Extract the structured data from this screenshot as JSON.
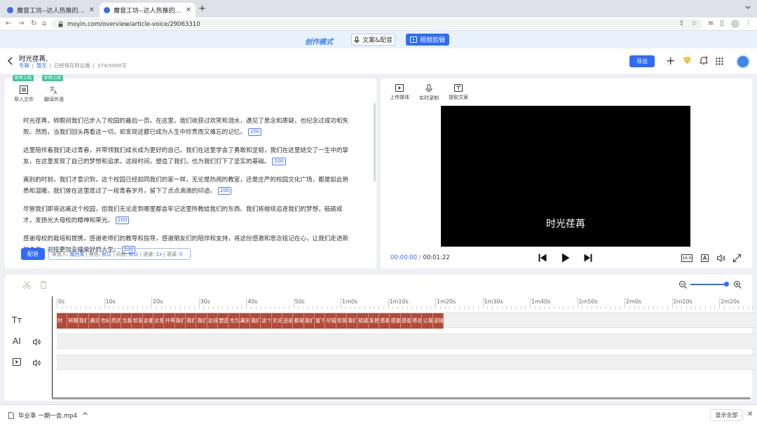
{
  "browser": {
    "tabs": [
      {
        "title": "魔音工坊--达人热推的短视频/有声...",
        "active": false
      },
      {
        "title": "魔音工坊--达人热推的短视频/有声...",
        "active": true
      }
    ],
    "new_tab": "+",
    "url": "moyin.com/overview/article-voice/29063310"
  },
  "modebar": {
    "mode_label": "创作模式",
    "btn_text_voice": "文案&配音",
    "btn_video_edit": "视频剪辑"
  },
  "header": {
    "title": "时光荏苒,",
    "tag1": "专辑",
    "tag2": "暂无",
    "save_status": "已经保存到云端",
    "word_count": "374/5000字",
    "export_label": "导出"
  },
  "editor": {
    "tools": [
      {
        "label": "导入文件",
        "badge": "即将上线"
      },
      {
        "label": "翻译外语",
        "badge": "即将上线"
      }
    ],
    "paragraphs": [
      {
        "text": "时光荏苒，转眼间我们已步入了校园的最后一页。在这里，我们收获过欢笑和泪水，遇见了思念和质疑，也纪念过成功和失败。然而，当我们回头再看这一切，却发现这都已成为人生中珍贵而又难忘的记忆。",
        "count": "200"
      },
      {
        "text": "这里陪伴着我们走过青春，并带领我们成长成为更好的自己。我们在这里学会了勇敢和坚韧，我们在这里结交了一生中的挚友，在这里发现了自己的梦想和追求。这段时间，塑造了我们，也为我们打下了坚实的基础。",
        "count": "200"
      },
      {
        "text": "离别的时刻，我们才意识到，这个校园已经如同我们的家一样，无论是热闹的教室，还是庄严的校园文化广场，都是如此熟悉和温暖。我们曾在这里度过了一段青春岁月，留下了点点滴滴的印迹。",
        "count": "200"
      },
      {
        "text": "尽管我们即将远离这个校园，但我们无论走到哪里都会牢记这里所教给我们的东西。我们将继续追逐我们的梦想，砥砺成才，发扬光大母校的精神和荣光。",
        "count": "200"
      },
      {
        "text": "感谢母校的栽培和提携，感谢老师们的教导和指导，感谢朋友们的陪伴和支持，将这份感激和思念铭记在心，让我们走进新的未来，迎接更加幸福美好的人生。",
        "count": "200"
      }
    ],
    "dub_button": "配音",
    "voice_settings": {
      "speaker_label": "发音人:",
      "speaker": "魔西毒",
      "role_label": "角色:",
      "role": "默认",
      "style_label": "风格:",
      "style": "默认",
      "speed_label": "语速:",
      "speed": "1x",
      "pitch_label": "语调:",
      "pitch": "0"
    }
  },
  "preview": {
    "tools": [
      {
        "label": "上传媒体"
      },
      {
        "label": "实时录制"
      },
      {
        "label": "提取文案"
      }
    ],
    "subtitle": "时光荏苒",
    "current_time": "00:00:00",
    "separator": "/",
    "total_time": "00:01:22",
    "aspect": "16:9",
    "colors": {
      "accent": "#2f6bff",
      "video_bg": "#000000",
      "clip": "#b24a3a"
    }
  },
  "timeline": {
    "ticks": [
      "0s",
      "10s",
      "20s",
      "30s",
      "40s",
      "50s",
      "1m0s",
      "1m10s",
      "1m20s",
      "1m30s",
      "1m40s",
      "1m50s",
      "2m0s",
      "2m10s",
      "2m20s"
    ],
    "tracks": [
      {
        "icon": "text-track-icon",
        "label": "Tт"
      },
      {
        "icon": "ai-voice-track-icon",
        "label": "AI"
      },
      {
        "icon": "video-track-icon",
        "label": ""
      }
    ],
    "clips": [
      "时",
      "转眼间",
      "我们已",
      "遇见了",
      "也纪",
      "然而,",
      "当我们",
      "却发现",
      "这都已",
      "这里陪",
      "并带领",
      "我们在",
      "我们在",
      "我们在",
      "这段时",
      "塑造了",
      "也为我",
      "离别",
      "我们才",
      "这个校",
      "无论是",
      "还是庄",
      "都是如",
      "我们曾",
      "留下了",
      "尽管",
      "但我们",
      "我们将",
      "砥砺",
      "发扬光",
      "感谢",
      "感谢老",
      "感谢朋",
      "将这份",
      "让我们",
      "迎接"
    ]
  },
  "downloads": {
    "file": "毕业季 一期一会.mp4",
    "show_all": "显示全部"
  }
}
